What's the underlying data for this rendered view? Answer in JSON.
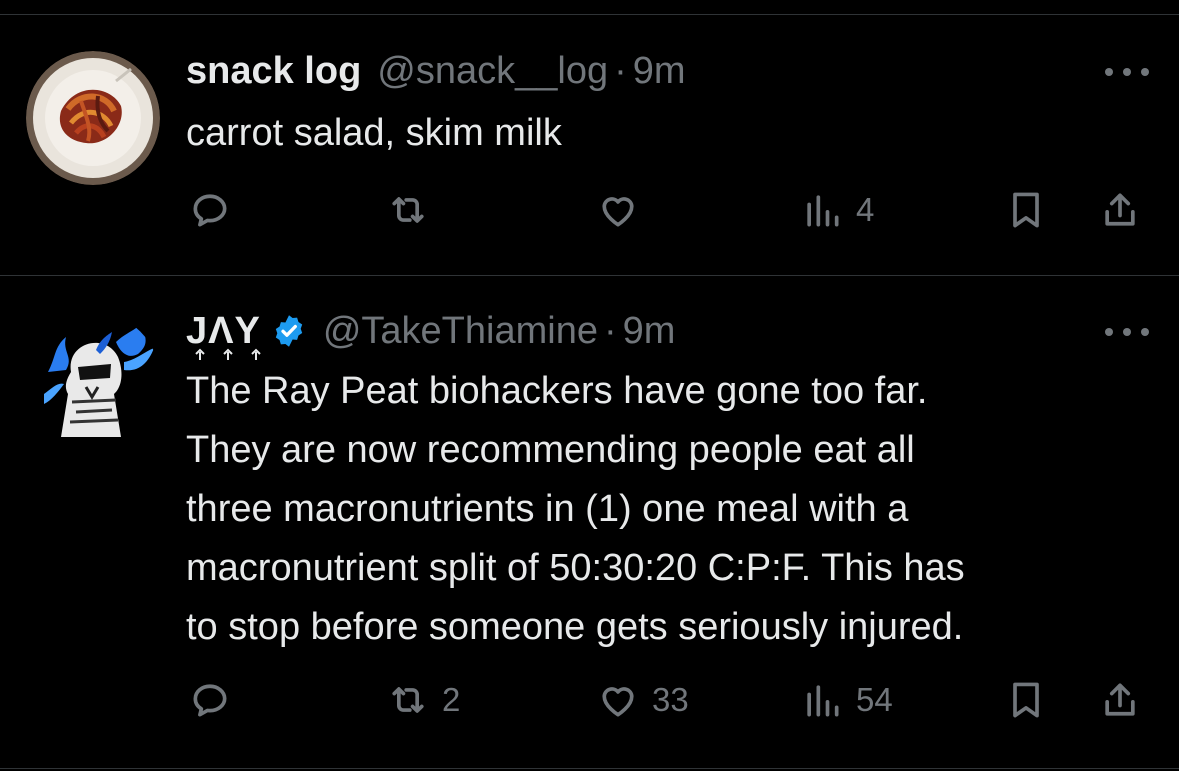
{
  "tweets": [
    {
      "display_name": "snack log",
      "handle": "@snack__log",
      "separator": "·",
      "time": "9m",
      "avatar_icon": "carrot-salad-plate-avatar",
      "text": "carrot salad, skim milk",
      "actions": {
        "reply_count": "",
        "retweet_count": "",
        "like_count": "",
        "views_count": "4"
      }
    },
    {
      "display_name": "JΛY",
      "handle": "@TakeThiamine",
      "separator": "·",
      "time": "9m",
      "verified": true,
      "avatar_icon": "armored-figure-blue-flames-avatar",
      "text_lines": [
        "The Ray Peat biohackers have gone too far.",
        "They are now recommending people eat all",
        "three macronutrients in (1) one meal with a",
        "macronutrient split of 50:30:20 C:P:F. This has",
        "to stop before someone gets seriously injured."
      ],
      "actions": {
        "reply_count": "",
        "retweet_count": "2",
        "like_count": "33",
        "views_count": "54"
      }
    }
  ],
  "colors": {
    "background": "#000000",
    "text_primary": "#e7e9ea",
    "text_secondary": "#71767b",
    "divider": "#2f3336",
    "verified_blue": "#1d9bf0"
  }
}
